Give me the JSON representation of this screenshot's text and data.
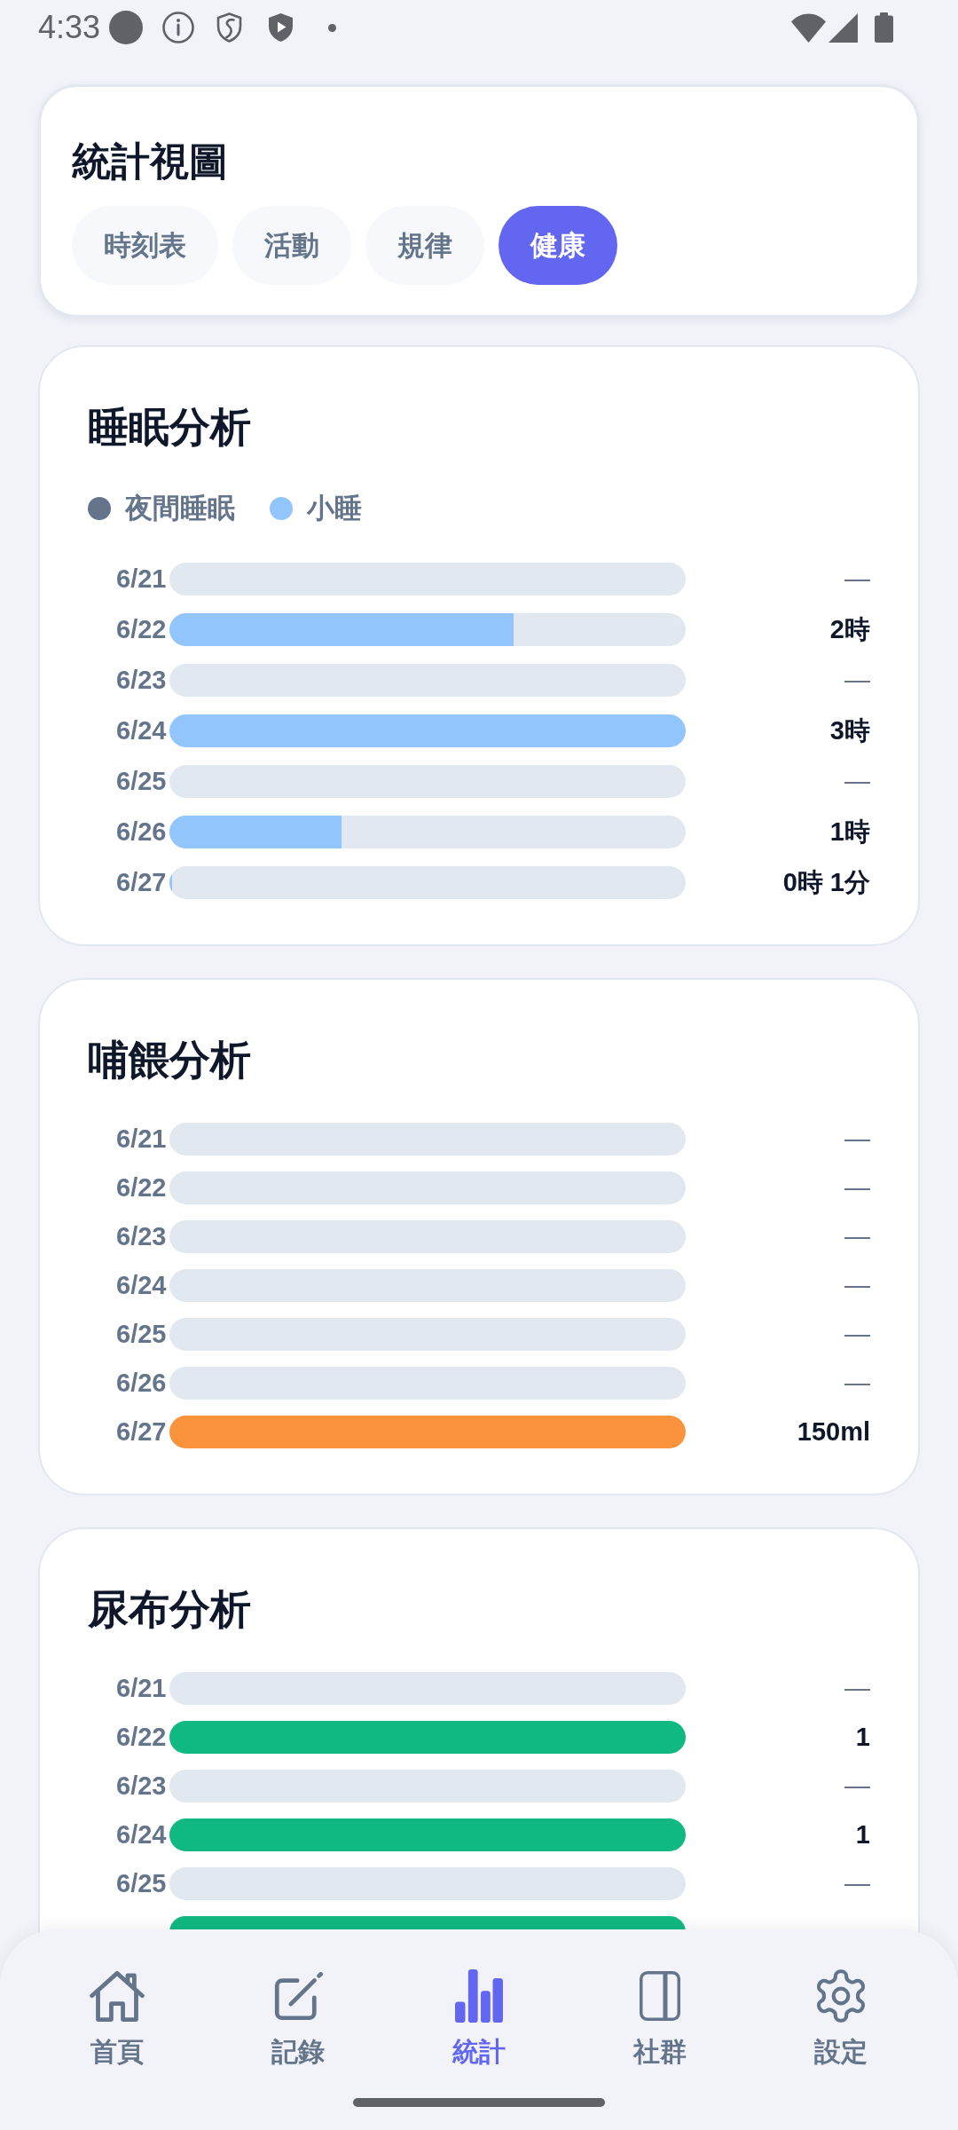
{
  "status_bar": {
    "time": "4:33"
  },
  "view_card": {
    "title": "統計視圖",
    "tabs": [
      {
        "label": "時刻表",
        "selected": false
      },
      {
        "label": "活動",
        "selected": false
      },
      {
        "label": "規律",
        "selected": false
      },
      {
        "label": "健康",
        "selected": true
      }
    ]
  },
  "sections": [
    {
      "title": "睡眠分析",
      "color": "#93c5fd",
      "legend": [
        {
          "label": "夜間睡眠",
          "color": "#64748b"
        },
        {
          "label": "小睡",
          "color": "#93c5fd"
        }
      ],
      "rows": [
        {
          "date": "6/21",
          "value": "—"
        },
        {
          "date": "6/22",
          "level": 0.667,
          "value": "2時"
        },
        {
          "date": "6/23",
          "value": "—"
        },
        {
          "date": "6/24",
          "level": 1,
          "value": "3時"
        },
        {
          "date": "6/25",
          "value": "—"
        },
        {
          "date": "6/26",
          "level": 0.333,
          "value": "1時"
        },
        {
          "date": "6/27",
          "level": 0.006,
          "value": "0時 1分"
        }
      ]
    },
    {
      "title": "哺餵分析",
      "color": "#fb923c",
      "rows": [
        {
          "date": "6/21",
          "value": "—"
        },
        {
          "date": "6/22",
          "value": "—"
        },
        {
          "date": "6/23",
          "value": "—"
        },
        {
          "date": "6/24",
          "value": "—"
        },
        {
          "date": "6/25",
          "value": "—"
        },
        {
          "date": "6/26",
          "value": "—"
        },
        {
          "date": "6/27",
          "level": 1,
          "value": "150ml"
        }
      ]
    },
    {
      "title": "尿布分析",
      "color": "#10b981",
      "rows": [
        {
          "date": "6/21",
          "value": "—"
        },
        {
          "date": "6/22",
          "level": 1,
          "value": "1"
        },
        {
          "date": "6/23",
          "value": "—"
        },
        {
          "date": "6/24",
          "level": 1,
          "value": "1"
        },
        {
          "date": "6/25",
          "value": "—"
        },
        {
          "level": 1
        }
      ]
    }
  ],
  "nav": [
    {
      "label": "首頁",
      "selected": false
    },
    {
      "label": "記錄",
      "selected": false
    },
    {
      "label": "統計",
      "selected": true
    },
    {
      "label": "社群",
      "selected": false
    },
    {
      "label": "設定",
      "selected": false
    }
  ]
}
